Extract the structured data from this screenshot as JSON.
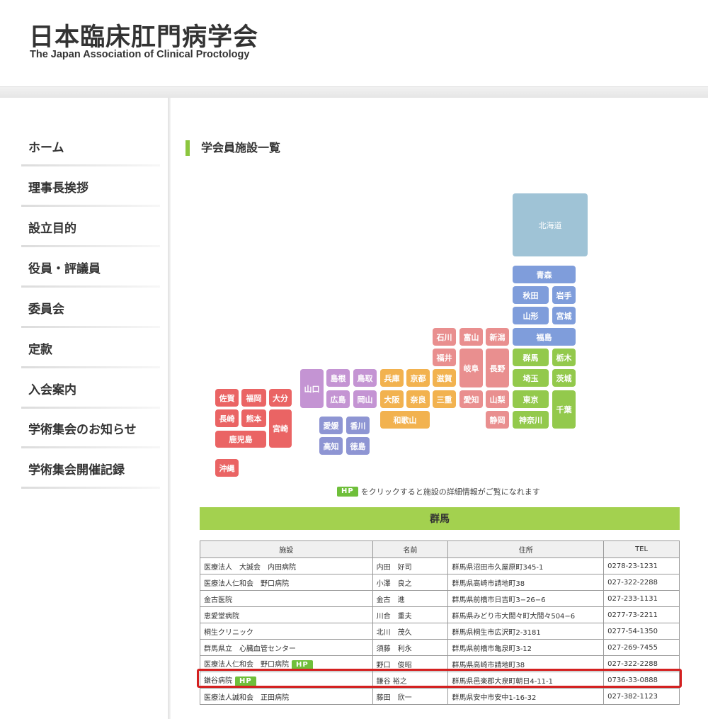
{
  "header": {
    "logo_jp": "日本臨床肛門病学会",
    "logo_en": "The Japan Association of Clinical Proctology"
  },
  "nav": [
    "ホーム",
    "理事長挨拶",
    "設立目的",
    "役員・評議員",
    "委員会",
    "定款",
    "入会案内",
    "学術集会のお知らせ",
    "学術集会開催記録"
  ],
  "section_title": "学会員施設一覧",
  "colors": {
    "hokkaido": "#9fc3d6",
    "tohoku": "#7f9ddb",
    "kanto": "#93c94c",
    "chubu": "#e98f8f",
    "kinki": "#f2b24f",
    "chugoku": "#c494d3",
    "shikoku": "#8e95d3",
    "kyushu": "#ea6464"
  },
  "prefectures": {
    "hokkaido": "北海道",
    "aomori": "青森",
    "akita": "秋田",
    "iwate": "岩手",
    "yamagata": "山形",
    "miyagi": "宮城",
    "fukushima": "福島",
    "ishikawa": "石川",
    "toyama": "富山",
    "niigata": "新潟",
    "fukui": "福井",
    "gifu": "岐阜",
    "nagano": "長野",
    "gunma": "群馬",
    "tochigi": "栃木",
    "saitama": "埼玉",
    "ibaraki": "茨城",
    "tokyo": "東京",
    "chiba": "千葉",
    "kanagawa": "神奈川",
    "aichi": "愛知",
    "yamanashi": "山梨",
    "shizuoka": "静岡",
    "hyogo": "兵庫",
    "kyoto": "京都",
    "shiga": "滋賀",
    "osaka": "大阪",
    "nara": "奈良",
    "mie": "三重",
    "wakayama": "和歌山",
    "yamaguchi": "山口",
    "shimane": "島根",
    "tottori": "鳥取",
    "hiroshima": "広島",
    "okayama": "岡山",
    "ehime": "愛媛",
    "kagawa": "香川",
    "kochi": "高知",
    "tokushima": "徳島",
    "saga": "佐賀",
    "fukuoka": "福岡",
    "oita": "大分",
    "nagasaki": "長崎",
    "kumamoto": "熊本",
    "miyazaki": "宮崎",
    "kagoshima": "鹿児島",
    "okinawa": "沖縄"
  },
  "hp_note": {
    "badge": "HP",
    "text": "をクリックすると施設の詳細情報がご覧になれます"
  },
  "region": "群馬",
  "table": {
    "headers": [
      "施設",
      "名前",
      "住所",
      "TEL"
    ],
    "rows": [
      {
        "facility": "医療法人　大誠会　内田病院",
        "hp": "",
        "name": "内田　好司",
        "address": "群馬県沼田市久屋原町345-1",
        "tel": "0278-23-1231"
      },
      {
        "facility": "医療法人仁和会　野口病院",
        "hp": "",
        "name": "小澤　良之",
        "address": "群馬県高崎市請地町38",
        "tel": "027-322-2288"
      },
      {
        "facility": "金古医院",
        "hp": "",
        "name": "金古　進",
        "address": "群馬県前橋市日吉町3−26−6",
        "tel": "027-233-1131"
      },
      {
        "facility": "恵愛堂病院",
        "hp": "",
        "name": "川合　重夫",
        "address": "群馬県みどり市大間々町大間々504−6",
        "tel": "0277-73-2211"
      },
      {
        "facility": "桐生クリニック",
        "hp": "",
        "name": "北川　茂久",
        "address": "群馬県桐生市広沢町2-3181",
        "tel": "0277-54-1350"
      },
      {
        "facility": "群馬県立　心臓血管センター",
        "hp": "",
        "name": "須藤　利永",
        "address": "群馬県前橋市亀泉町3-12",
        "tel": "027-269-7455"
      },
      {
        "facility": "医療法人仁和会　野口病院",
        "hp": "HP",
        "name": "野口　俊昭",
        "address": "群馬県高崎市請地町38",
        "tel": "027-322-2288"
      },
      {
        "facility": "鎌谷病院",
        "hp": "HP",
        "name": "鎌谷 裕之",
        "address": "群馬県邑楽郡大泉町朝日4-11-1",
        "tel": "0736-33-0888"
      },
      {
        "facility": "医療法人誠和会　正田病院",
        "hp": "",
        "name": "藤田　欣一",
        "address": "群馬県安中市安中1-16-32",
        "tel": "027-382-1123"
      }
    ]
  }
}
